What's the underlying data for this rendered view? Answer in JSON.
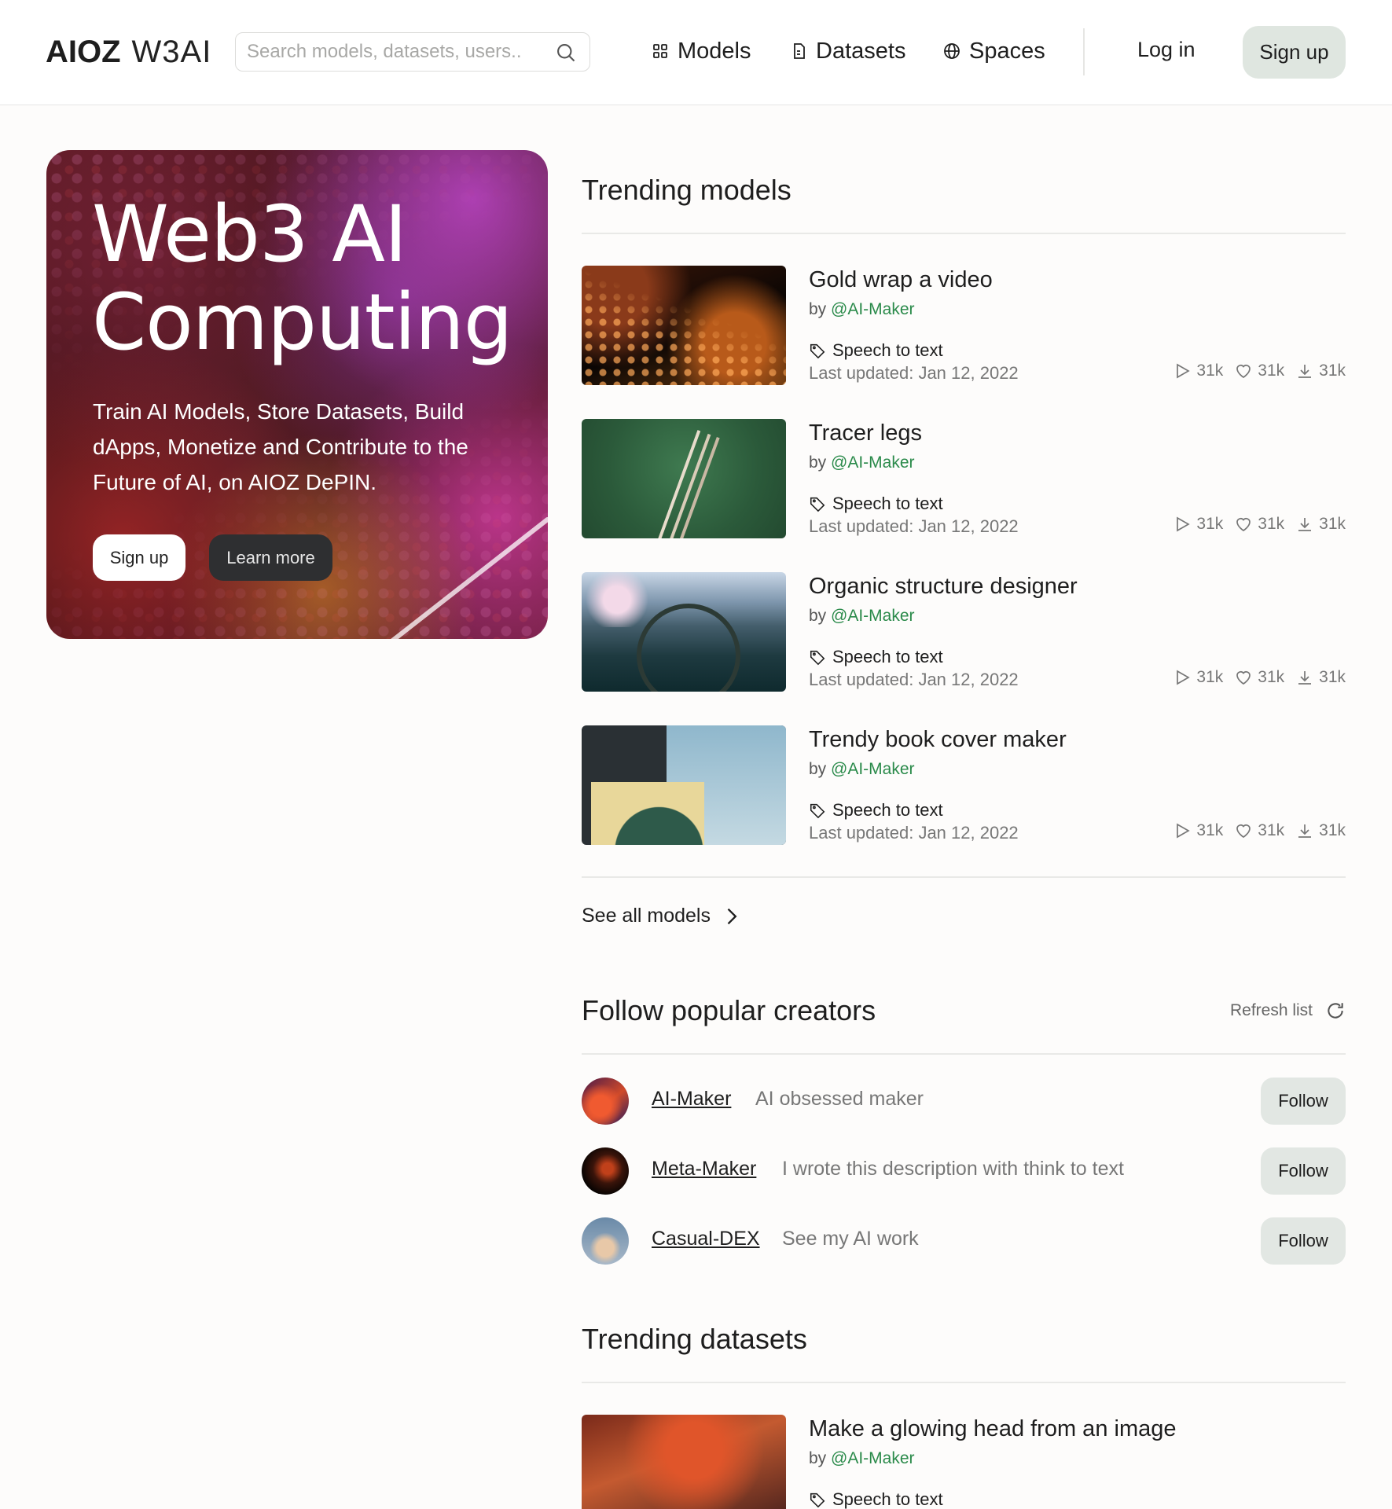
{
  "header": {
    "logo_mark": "AIOZ",
    "logo_text": "W3AI",
    "search_placeholder": "Search models, datasets, users..",
    "nav": [
      {
        "label": "Models",
        "icon": "grid-icon"
      },
      {
        "label": "Datasets",
        "icon": "file-icon"
      },
      {
        "label": "Spaces",
        "icon": "globe-icon"
      }
    ],
    "login_label": "Log in",
    "signup_label": "Sign up"
  },
  "hero": {
    "title_line1": "Web3 AI",
    "title_line2": "Computing",
    "description": "Train AI Models, Store Datasets, Build dApps, Monetize and Contribute to the Future of AI, on AIOZ DePIN.",
    "signup_label": "Sign up",
    "learn_more_label": "Learn more"
  },
  "trending_models": {
    "title": "Trending models",
    "items": [
      {
        "title": "Gold wrap a video",
        "by": "by ",
        "author": "@AI-Maker",
        "tag": "Speech to text",
        "updated": "Last updated: Jan 12, 2022",
        "plays": "31k",
        "likes": "31k",
        "downloads": "31k"
      },
      {
        "title": "Tracer legs",
        "by": "by ",
        "author": "@AI-Maker",
        "tag": "Speech to text",
        "updated": "Last updated: Jan 12, 2022",
        "plays": "31k",
        "likes": "31k",
        "downloads": "31k"
      },
      {
        "title": "Organic structure designer",
        "by": "by ",
        "author": "@AI-Maker",
        "tag": "Speech to text",
        "updated": "Last updated: Jan 12, 2022",
        "plays": "31k",
        "likes": "31k",
        "downloads": "31k"
      },
      {
        "title": "Trendy book cover maker",
        "by": "by ",
        "author": "@AI-Maker",
        "tag": "Speech to text",
        "updated": "Last updated: Jan 12, 2022",
        "plays": "31k",
        "likes": "31k",
        "downloads": "31k"
      }
    ],
    "see_all_label": "See all models"
  },
  "creators": {
    "title": "Follow popular creators",
    "refresh_label": "Refresh list",
    "items": [
      {
        "name": "AI-Maker",
        "description": "AI obsessed maker",
        "follow_label": "Follow"
      },
      {
        "name": "Meta-Maker",
        "description": "I wrote this description with think to text",
        "follow_label": "Follow"
      },
      {
        "name": "Casual-DEX",
        "description": "See my AI work",
        "follow_label": "Follow"
      }
    ]
  },
  "trending_datasets": {
    "title": "Trending datasets",
    "items": [
      {
        "title": "Make a glowing head from an image",
        "by": "by ",
        "author": "@AI-Maker",
        "tag": "Speech to text"
      }
    ]
  },
  "colors": {
    "accent_green": "#2a8a4a",
    "button_green_bg": "#dfe6e0",
    "page_bg": "#fdfcfb"
  }
}
